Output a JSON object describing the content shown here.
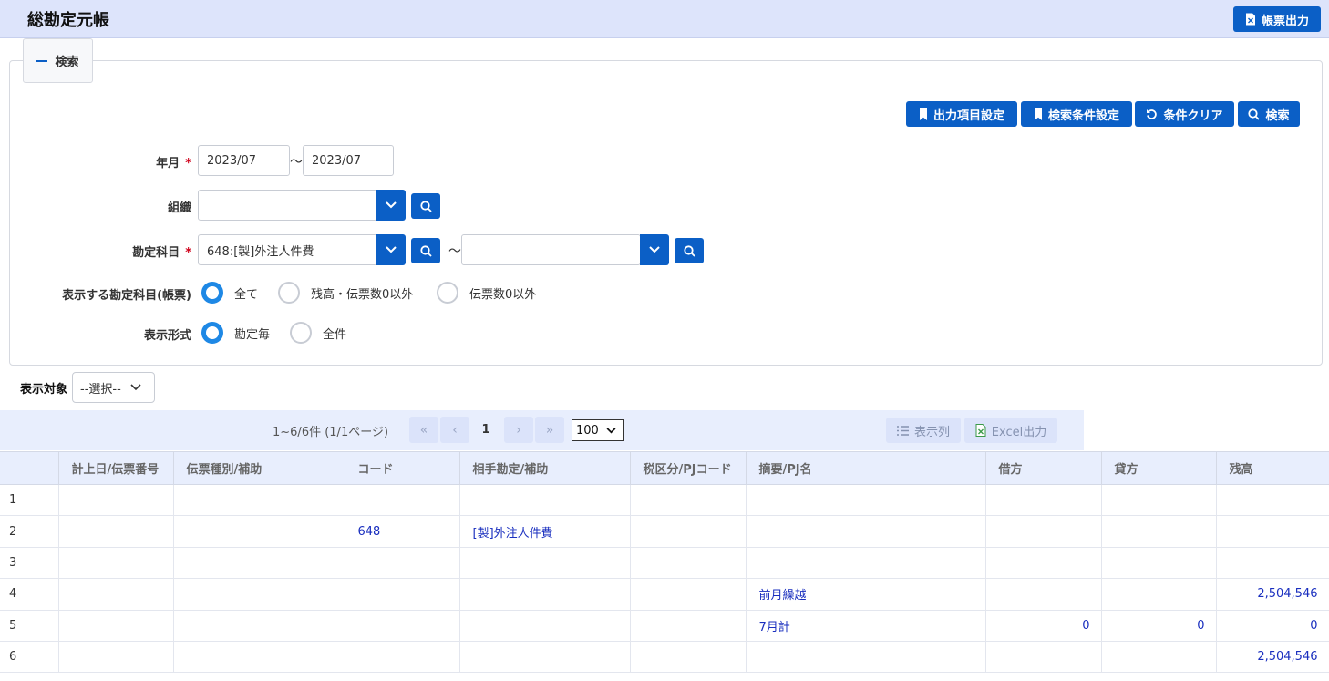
{
  "header": {
    "title": "総勘定元帳",
    "export_label": "帳票出力"
  },
  "panel": {
    "tab_label": "検索"
  },
  "actions": {
    "output_settings": "出力項目設定",
    "search_settings": "検索条件設定",
    "clear": "条件クリア",
    "search": "検索"
  },
  "form": {
    "period": {
      "label": "年月",
      "required": "*",
      "from": "2023/07",
      "sep": "～",
      "to": "2023/07"
    },
    "org": {
      "label": "組織",
      "value": ""
    },
    "account": {
      "label": "勘定科目",
      "required": "*",
      "from": "648:[製]外注人件費",
      "sep": "～",
      "to": ""
    },
    "display_accounts": {
      "label": "表示する勘定科目(帳票)",
      "options": [
        "全て",
        "残高・伝票数0以外",
        "伝票数0以外"
      ],
      "selected": 0
    },
    "display_format": {
      "label": "表示形式",
      "options": [
        "勘定毎",
        "全件"
      ],
      "selected": 0
    }
  },
  "target": {
    "label": "表示対象",
    "value": "--選択--"
  },
  "pager": {
    "info": "1~6/6件 (1/1ページ)",
    "current": "1",
    "per_page": "100",
    "columns_label": "表示列",
    "excel_label": "Excel出力"
  },
  "colors": {
    "primary": "#0b5fc6",
    "header_bg": "#dde4fb",
    "link": "#1a2fbf",
    "required": "#d0021b"
  },
  "table": {
    "columns": [
      "",
      "計上日/伝票番号",
      "伝票種別/補助",
      "コード",
      "相手勘定/補助",
      "税区分/PJコード",
      "摘要/PJ名",
      "借方",
      "貸方",
      "残高"
    ],
    "rows": [
      [
        "1",
        "",
        "",
        "",
        "",
        "",
        "",
        "",
        "",
        ""
      ],
      [
        "2",
        "",
        "",
        "648",
        "[製]外注人件費",
        "",
        "",
        "",
        "",
        ""
      ],
      [
        "3",
        "",
        "",
        "",
        "",
        "",
        "",
        "",
        "",
        ""
      ],
      [
        "4",
        "",
        "",
        "",
        "",
        "",
        "前月繰越",
        "",
        "",
        "2,504,546"
      ],
      [
        "5",
        "",
        "",
        "",
        "",
        "",
        "7月計",
        "0",
        "0",
        "0"
      ],
      [
        "6",
        "",
        "",
        "",
        "",
        "",
        "",
        "",
        "",
        "2,504,546"
      ]
    ]
  }
}
